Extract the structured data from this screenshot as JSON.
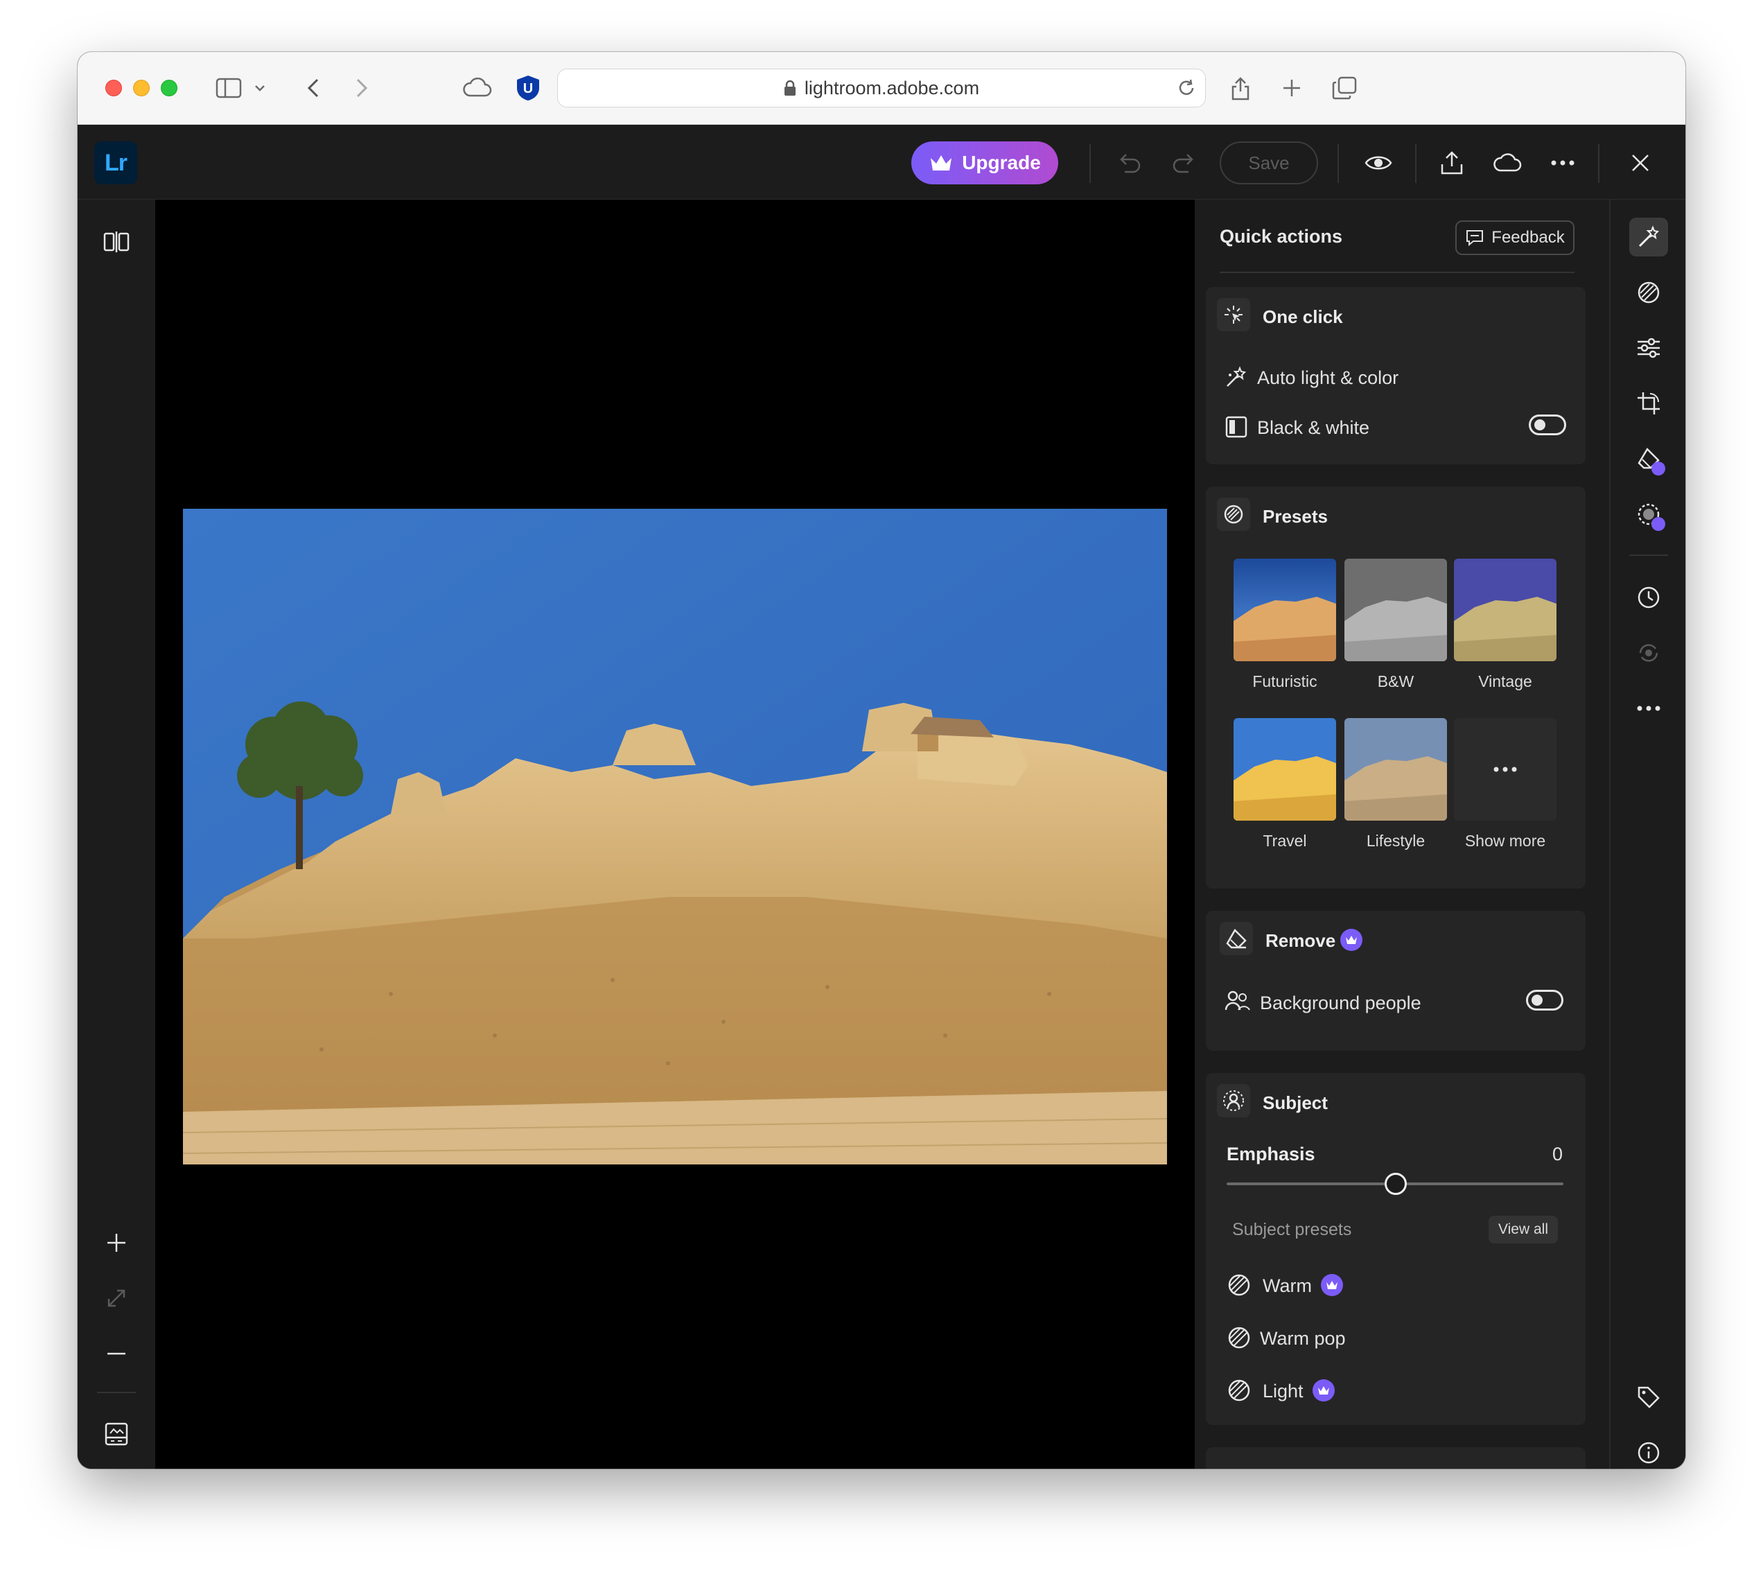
{
  "browser": {
    "url": "lightroom.adobe.com",
    "extension_letter": "U"
  },
  "app": {
    "logo_text": "Lr",
    "upgrade_label": "Upgrade",
    "save_label": "Save"
  },
  "panel": {
    "title": "Quick actions",
    "feedback_label": "Feedback",
    "one_click": {
      "title": "One click",
      "auto_label": "Auto light & color",
      "bw_label": "Black & white",
      "bw_on": false
    },
    "presets": {
      "title": "Presets",
      "items": [
        {
          "label": "Futuristic"
        },
        {
          "label": "B&W"
        },
        {
          "label": "Vintage"
        },
        {
          "label": "Travel"
        },
        {
          "label": "Lifestyle"
        },
        {
          "label": "Show more"
        }
      ]
    },
    "remove": {
      "title": "Remove",
      "background_label": "Background people",
      "background_on": false
    },
    "subject": {
      "title": "Subject",
      "emphasis_label": "Emphasis",
      "emphasis_value": "0",
      "presets_label": "Subject presets",
      "view_all_label": "View all",
      "items": [
        {
          "label": "Warm",
          "premium": true
        },
        {
          "label": "Warm pop",
          "premium": false
        },
        {
          "label": "Light",
          "premium": true
        }
      ]
    }
  },
  "colors": {
    "accent_purple": "#7b5cf7",
    "lr_blue": "#31a8ff",
    "lr_navy": "#001e36"
  }
}
